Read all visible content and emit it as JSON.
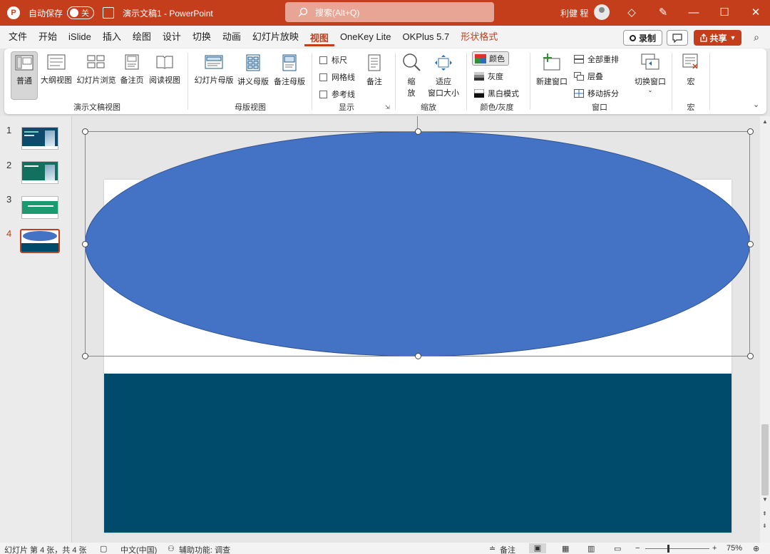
{
  "titlebar": {
    "app_icon": "P",
    "autosave_label": "自动保存",
    "autosave_state": "关",
    "doc_title": "演示文稿1 - PowerPoint",
    "search_placeholder": "搜索(Alt+Q)",
    "user_name": "利健 程"
  },
  "menu": {
    "items": [
      "文件",
      "开始",
      "iSlide",
      "插入",
      "绘图",
      "设计",
      "切换",
      "动画",
      "幻灯片放映",
      "视图",
      "OneKey Lite",
      "OKPlus 5.7",
      "形状格式"
    ],
    "active_index": 9,
    "accent_index": 12,
    "record_label": "录制",
    "share_label": "共享"
  },
  "ribbon": {
    "presentation_views": {
      "group_label": "演示文稿视图",
      "buttons": [
        "普通",
        "大纲视图",
        "幻灯片浏览",
        "备注页",
        "阅读视图"
      ]
    },
    "master_views": {
      "group_label": "母版视图",
      "buttons": [
        "幻灯片母版",
        "讲义母版",
        "备注母版"
      ]
    },
    "show": {
      "group_label": "显示",
      "checkboxes": [
        "标尺",
        "网格线",
        "参考线"
      ],
      "notes_label": "备注"
    },
    "zoom": {
      "group_label": "缩放",
      "zoom_label_1": "缩",
      "zoom_label_2": "放",
      "fit_label_1": "适应",
      "fit_label_2": "窗口大小"
    },
    "color": {
      "group_label": "颜色/灰度",
      "color_label": "颜色",
      "gray_label": "灰度",
      "bw_label": "黑白模式"
    },
    "window": {
      "group_label": "窗口",
      "new_window": "新建窗口",
      "arrange_all": "全部重排",
      "cascade": "层叠",
      "move_split": "移动拆分",
      "switch_window": "切换窗口"
    },
    "macro": {
      "group_label": "宏",
      "macro_label": "宏"
    }
  },
  "slides": {
    "numbers": [
      "1",
      "2",
      "3",
      "4"
    ],
    "active_index": 3
  },
  "slide_content": {
    "ellipse_color": "#4472c4",
    "band_color": "#004a6c"
  },
  "statusbar": {
    "slide_info": "幻灯片 第 4 张，共 4 张",
    "language": "中文(中国)",
    "accessibility": "辅助功能: 调查",
    "notes_label": "备注",
    "zoom_level": "75%"
  },
  "colors": {
    "brand": "#c43e1c"
  }
}
